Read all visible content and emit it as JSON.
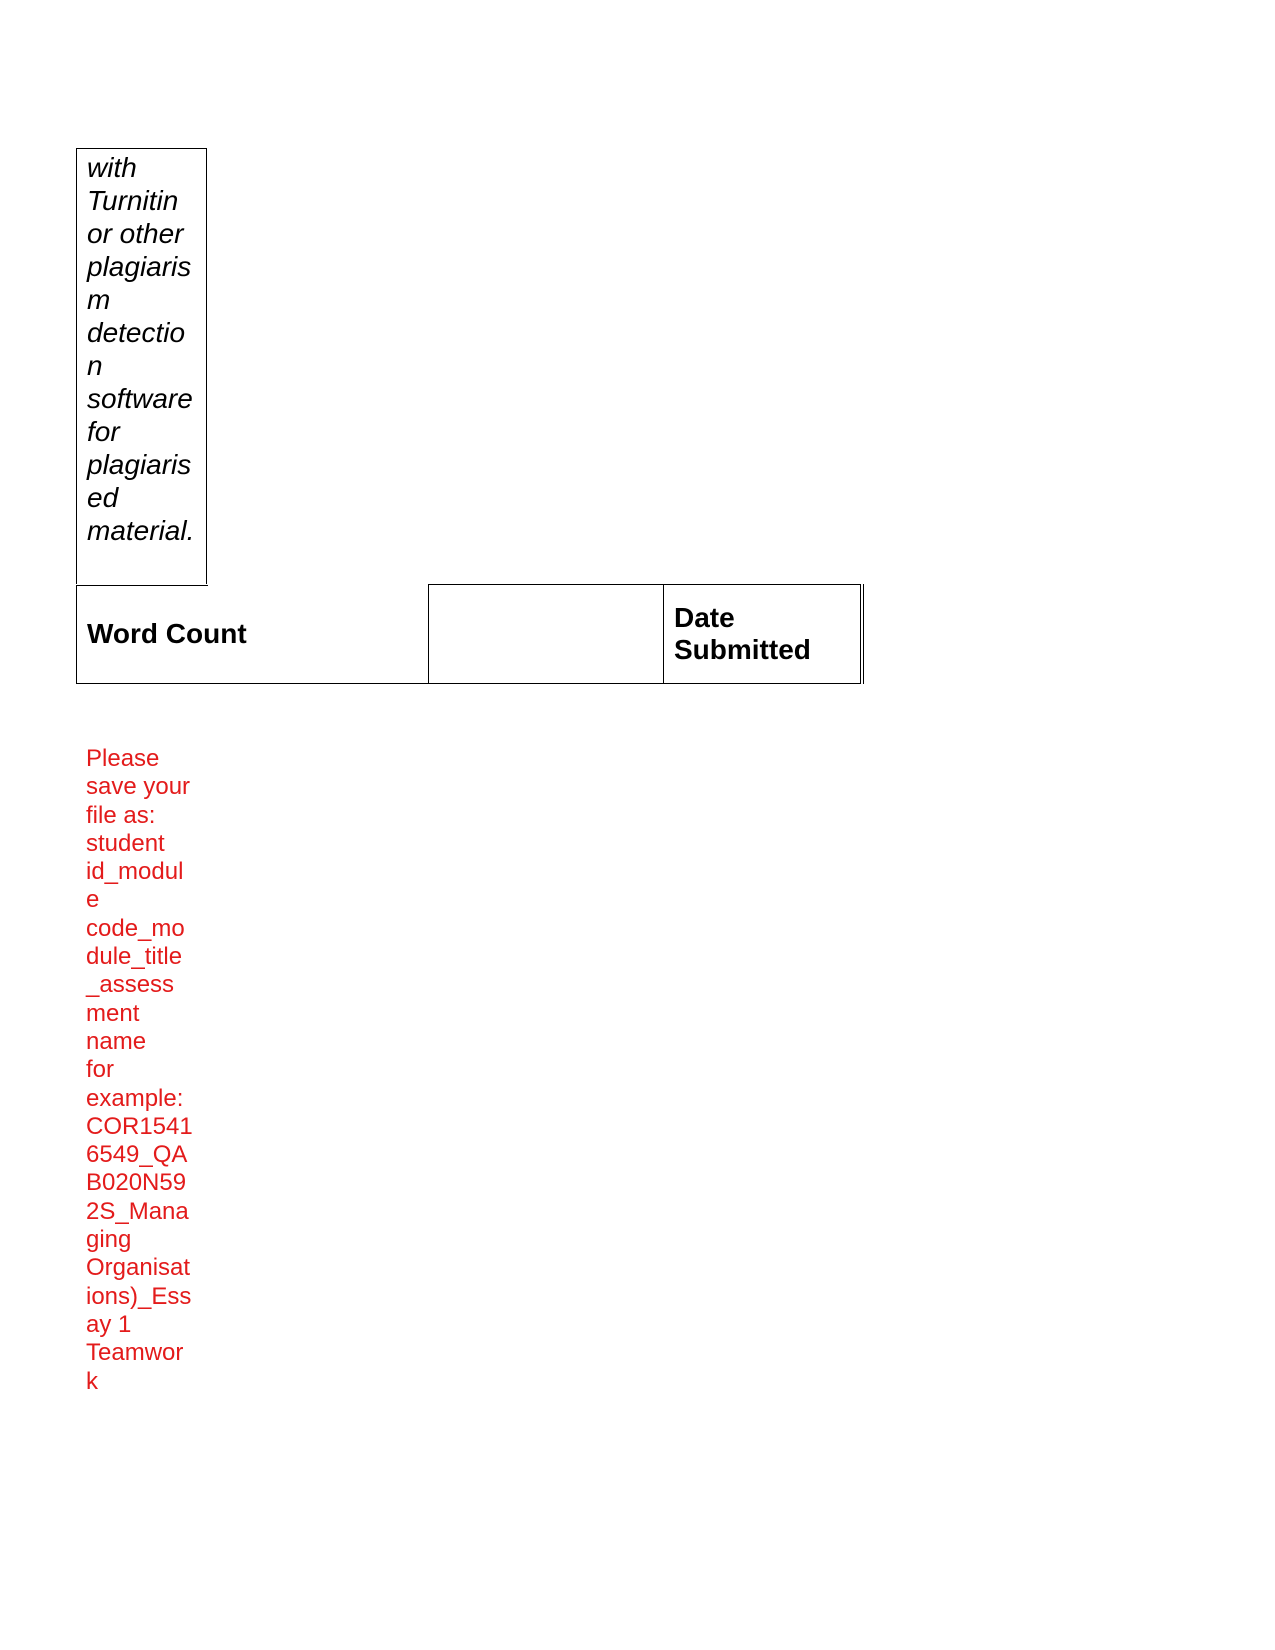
{
  "document": {
    "top_cell": {
      "lines": [
        "with",
        "Turnitin",
        "or other",
        "plagiaris",
        "m",
        "detectio",
        "n",
        "software",
        "for",
        "plagiaris",
        "ed",
        "material."
      ]
    },
    "table": {
      "word_count_label": "Word Count",
      "word_count_value": "",
      "date_submitted_label_line1": "Date",
      "date_submitted_label_line2": "Submitted"
    },
    "note": {
      "color": "#e31b1b",
      "lines": [
        "Please",
        "save your",
        "file as:",
        "student",
        "id_modul",
        "e",
        "code_mo",
        "dule_title",
        "_assess",
        "ment",
        "name",
        "for",
        "example:",
        "COR1541",
        "6549_QA",
        "B020N59",
        "2S_Mana",
        "ging",
        "Organisat",
        "ions)_Ess",
        "ay 1",
        "Teamwor",
        "k"
      ]
    }
  }
}
